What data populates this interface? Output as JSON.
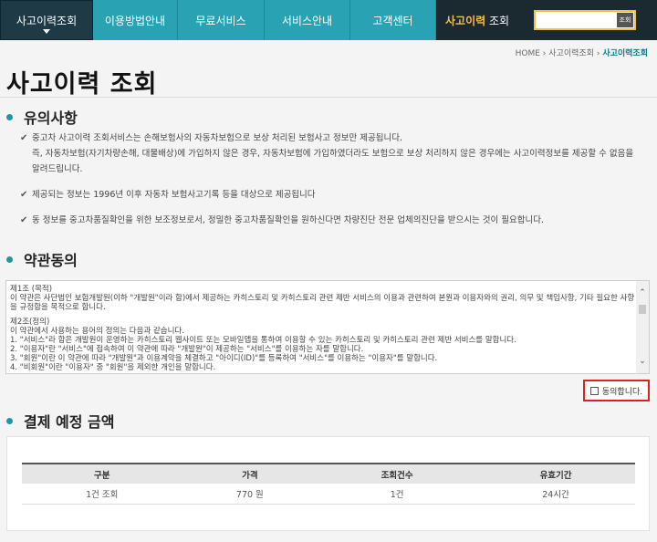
{
  "nav": {
    "items": [
      {
        "label": "사고이력조회"
      },
      {
        "label": "이용방법안내"
      },
      {
        "label": "무료서비스"
      },
      {
        "label": "서비스안내"
      },
      {
        "label": "고객센터"
      }
    ],
    "brand_highlight": "사고이력",
    "brand_rest": " 조회",
    "search_button": "조회",
    "search_value": ""
  },
  "breadcrumb": {
    "home": "HOME",
    "sep": "›",
    "parent": "사고이력조회",
    "current": "사고이력조회"
  },
  "page_title": "사고이력 조회",
  "notice": {
    "title": "유의사항",
    "items": [
      {
        "lines": [
          "중고차 사고이력 조회서비스는 손해보험사의 자동차보험으로 보상 처리된 보험사고 정보만 제공됩니다.",
          "즉, 자동차보험(자기차량손해, 대물배상)에 가입하지 않은 경우, 자동차보험에 가입하였더라도 보험으로 보상 처리하지 않은 경우에는 사고이력정보를 제공할 수 없음을 알려드립니다."
        ]
      },
      {
        "lines": [
          "제공되는 정보는 1996년 이후 자동차 보험사고기록 등을 대상으로 제공됩니다"
        ]
      },
      {
        "lines": [
          "동 정보를 중고차품질확인을 위한 보조정보로서, 정밀한 중고차품질확인을 원하신다면 차량진단 전문 업체의진단을 받으시는 것이 필요합니다."
        ]
      }
    ]
  },
  "terms": {
    "title": "약관동의",
    "paragraphs": [
      "제1조 (목적)\n이 약관은 사단법인 보험개발원(이하 \"개발원\"이라 함)에서 제공하는 카히스토리 및 카히스토리 관련 제반 서비스의 이용과 관련하여 본원과 이용자와의 권리, 의무 및 책임사항, 기타 필요한 사항을 규정함을 목적으로 합니다.",
      "제2조(정의)\n이 약관에서 사용하는 용어의 정의는 다음과 같습니다.\n1. \"서비스\"라 함은 개발원이 운영하는 카히스토리 웹사이트 또는 모바일앱을 통하여 이용할 수 있는 카히스토리 및 카히스토리 관련 제반 서비스를 말합니다.\n2. \"이용자\"란 \"서비스\"에 접속하여 이 약관에 따라 \"개발원\"이 제공하는 \"서비스\"를 이용하는 자를 말합니다.\n3. \"회원\"이란 이 약관에 따라 \"개발원\"과 이용계약을 체결하고 \"아이디(ID)\"를 등록하여 \"서비스\"를 이용하는 \"이용자\"를 말합니다.\n4. \"비회원\"이란 \"이용자\" 중 \"회원\"을 제외한 개인을 말합니다."
    ],
    "agree_label": "동의합니다."
  },
  "payment": {
    "title": "결제 예정 금액",
    "headers": [
      "구분",
      "가격",
      "조회건수",
      "유효기간"
    ],
    "rows": [
      [
        "1건 조회",
        "770 원",
        "1건",
        "24시간"
      ]
    ]
  }
}
